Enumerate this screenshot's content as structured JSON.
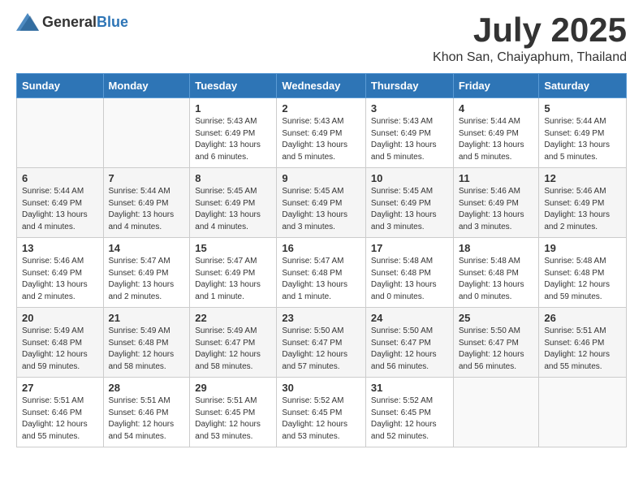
{
  "header": {
    "logo_general": "General",
    "logo_blue": "Blue",
    "month": "July 2025",
    "location": "Khon San, Chaiyaphum, Thailand"
  },
  "weekdays": [
    "Sunday",
    "Monday",
    "Tuesday",
    "Wednesday",
    "Thursday",
    "Friday",
    "Saturday"
  ],
  "weeks": [
    [
      {
        "day": "",
        "info": ""
      },
      {
        "day": "",
        "info": ""
      },
      {
        "day": "1",
        "info": "Sunrise: 5:43 AM\nSunset: 6:49 PM\nDaylight: 13 hours and 6 minutes."
      },
      {
        "day": "2",
        "info": "Sunrise: 5:43 AM\nSunset: 6:49 PM\nDaylight: 13 hours and 5 minutes."
      },
      {
        "day": "3",
        "info": "Sunrise: 5:43 AM\nSunset: 6:49 PM\nDaylight: 13 hours and 5 minutes."
      },
      {
        "day": "4",
        "info": "Sunrise: 5:44 AM\nSunset: 6:49 PM\nDaylight: 13 hours and 5 minutes."
      },
      {
        "day": "5",
        "info": "Sunrise: 5:44 AM\nSunset: 6:49 PM\nDaylight: 13 hours and 5 minutes."
      }
    ],
    [
      {
        "day": "6",
        "info": "Sunrise: 5:44 AM\nSunset: 6:49 PM\nDaylight: 13 hours and 4 minutes."
      },
      {
        "day": "7",
        "info": "Sunrise: 5:44 AM\nSunset: 6:49 PM\nDaylight: 13 hours and 4 minutes."
      },
      {
        "day": "8",
        "info": "Sunrise: 5:45 AM\nSunset: 6:49 PM\nDaylight: 13 hours and 4 minutes."
      },
      {
        "day": "9",
        "info": "Sunrise: 5:45 AM\nSunset: 6:49 PM\nDaylight: 13 hours and 3 minutes."
      },
      {
        "day": "10",
        "info": "Sunrise: 5:45 AM\nSunset: 6:49 PM\nDaylight: 13 hours and 3 minutes."
      },
      {
        "day": "11",
        "info": "Sunrise: 5:46 AM\nSunset: 6:49 PM\nDaylight: 13 hours and 3 minutes."
      },
      {
        "day": "12",
        "info": "Sunrise: 5:46 AM\nSunset: 6:49 PM\nDaylight: 13 hours and 2 minutes."
      }
    ],
    [
      {
        "day": "13",
        "info": "Sunrise: 5:46 AM\nSunset: 6:49 PM\nDaylight: 13 hours and 2 minutes."
      },
      {
        "day": "14",
        "info": "Sunrise: 5:47 AM\nSunset: 6:49 PM\nDaylight: 13 hours and 2 minutes."
      },
      {
        "day": "15",
        "info": "Sunrise: 5:47 AM\nSunset: 6:49 PM\nDaylight: 13 hours and 1 minute."
      },
      {
        "day": "16",
        "info": "Sunrise: 5:47 AM\nSunset: 6:48 PM\nDaylight: 13 hours and 1 minute."
      },
      {
        "day": "17",
        "info": "Sunrise: 5:48 AM\nSunset: 6:48 PM\nDaylight: 13 hours and 0 minutes."
      },
      {
        "day": "18",
        "info": "Sunrise: 5:48 AM\nSunset: 6:48 PM\nDaylight: 13 hours and 0 minutes."
      },
      {
        "day": "19",
        "info": "Sunrise: 5:48 AM\nSunset: 6:48 PM\nDaylight: 12 hours and 59 minutes."
      }
    ],
    [
      {
        "day": "20",
        "info": "Sunrise: 5:49 AM\nSunset: 6:48 PM\nDaylight: 12 hours and 59 minutes."
      },
      {
        "day": "21",
        "info": "Sunrise: 5:49 AM\nSunset: 6:48 PM\nDaylight: 12 hours and 58 minutes."
      },
      {
        "day": "22",
        "info": "Sunrise: 5:49 AM\nSunset: 6:47 PM\nDaylight: 12 hours and 58 minutes."
      },
      {
        "day": "23",
        "info": "Sunrise: 5:50 AM\nSunset: 6:47 PM\nDaylight: 12 hours and 57 minutes."
      },
      {
        "day": "24",
        "info": "Sunrise: 5:50 AM\nSunset: 6:47 PM\nDaylight: 12 hours and 56 minutes."
      },
      {
        "day": "25",
        "info": "Sunrise: 5:50 AM\nSunset: 6:47 PM\nDaylight: 12 hours and 56 minutes."
      },
      {
        "day": "26",
        "info": "Sunrise: 5:51 AM\nSunset: 6:46 PM\nDaylight: 12 hours and 55 minutes."
      }
    ],
    [
      {
        "day": "27",
        "info": "Sunrise: 5:51 AM\nSunset: 6:46 PM\nDaylight: 12 hours and 55 minutes."
      },
      {
        "day": "28",
        "info": "Sunrise: 5:51 AM\nSunset: 6:46 PM\nDaylight: 12 hours and 54 minutes."
      },
      {
        "day": "29",
        "info": "Sunrise: 5:51 AM\nSunset: 6:45 PM\nDaylight: 12 hours and 53 minutes."
      },
      {
        "day": "30",
        "info": "Sunrise: 5:52 AM\nSunset: 6:45 PM\nDaylight: 12 hours and 53 minutes."
      },
      {
        "day": "31",
        "info": "Sunrise: 5:52 AM\nSunset: 6:45 PM\nDaylight: 12 hours and 52 minutes."
      },
      {
        "day": "",
        "info": ""
      },
      {
        "day": "",
        "info": ""
      }
    ]
  ]
}
